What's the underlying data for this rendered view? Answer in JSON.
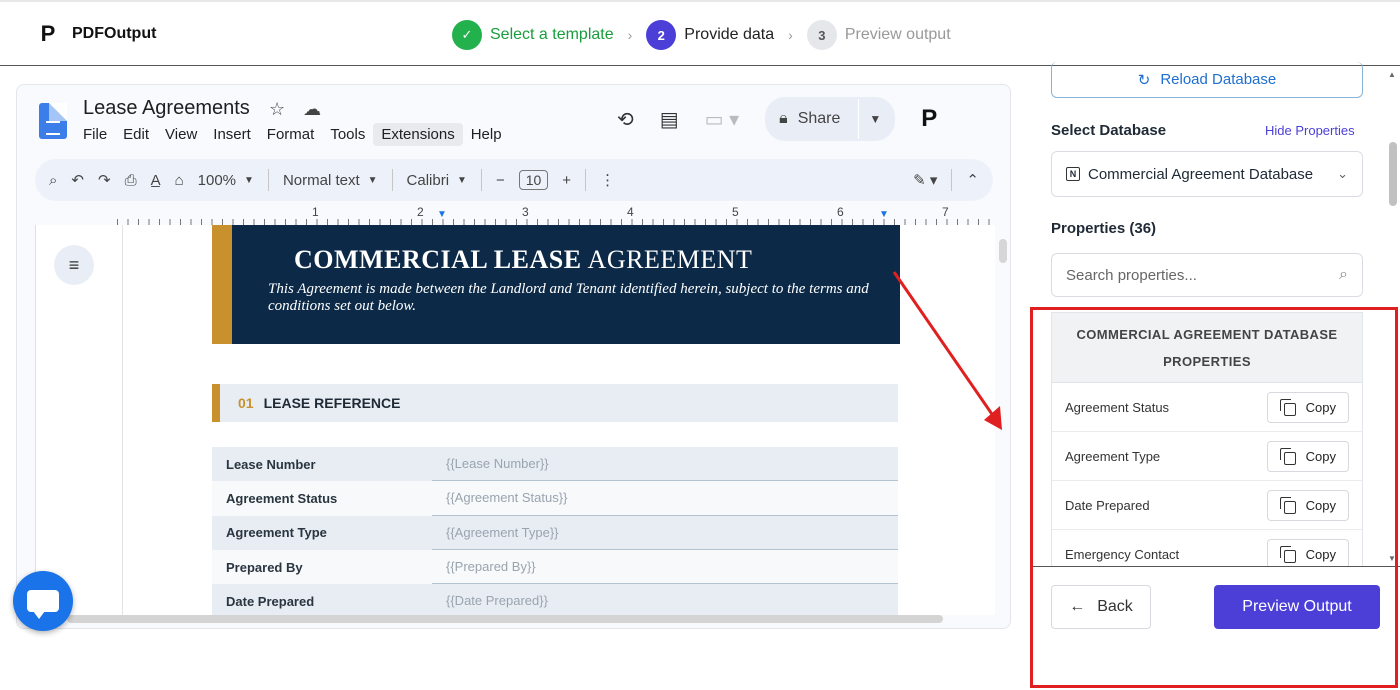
{
  "app": {
    "name": "PDFOutput",
    "logo_letter": "P"
  },
  "steps": [
    {
      "num": "✓",
      "label": "Select a template",
      "state": "done"
    },
    {
      "num": "2",
      "label": "Provide data",
      "state": "active"
    },
    {
      "num": "3",
      "label": "Preview output",
      "state": "todo"
    }
  ],
  "doc": {
    "title": "Lease Agreements",
    "menu": [
      "File",
      "Edit",
      "View",
      "Insert",
      "Format",
      "Tools",
      "Extensions",
      "Help"
    ],
    "share_label": "Share",
    "toolbar": {
      "zoom": "100%",
      "style": "Normal text",
      "font": "Calibri",
      "font_size": "10"
    },
    "ruler": [
      "1",
      "2",
      "3",
      "4",
      "5",
      "6",
      "7"
    ],
    "banner": {
      "title_bold": "COMMERCIAL LEASE",
      "title_regular": "AGREEMENT",
      "subtitle": "This Agreement is made between the Landlord and Tenant identified herein, subject to the terms and conditions set out below."
    },
    "section": {
      "num": "01",
      "title": "LEASE REFERENCE"
    },
    "fields": [
      {
        "label": "Lease Number",
        "value": "{{Lease Number}}"
      },
      {
        "label": "Agreement Status",
        "value": "{{Agreement Status}}"
      },
      {
        "label": "Agreement Type",
        "value": "{{Agreement Type}}"
      },
      {
        "label": "Prepared By",
        "value": "{{Prepared By}}"
      },
      {
        "label": "Date Prepared",
        "value": "{{Date Prepared}}"
      }
    ]
  },
  "panel": {
    "reload_label": "Reload Database",
    "select_db_label": "Select Database",
    "hide_props_link": "Hide Properties",
    "selected_db": "Commercial Agreement Database",
    "properties_label": "Properties (36)",
    "search_placeholder": "Search properties...",
    "props_header": "COMMERCIAL AGREEMENT DATABASE PROPERTIES",
    "copy_label": "Copy",
    "properties": [
      "Agreement Status",
      "Agreement Type",
      "Date Prepared",
      "Emergency Contact"
    ],
    "back_label": "Back",
    "preview_label": "Preview Output"
  },
  "colors": {
    "accent": "#4b3fd8",
    "done": "#22b14c",
    "banner": "#0c2a47",
    "gold": "#c9912d",
    "annotation": "#e02020"
  }
}
